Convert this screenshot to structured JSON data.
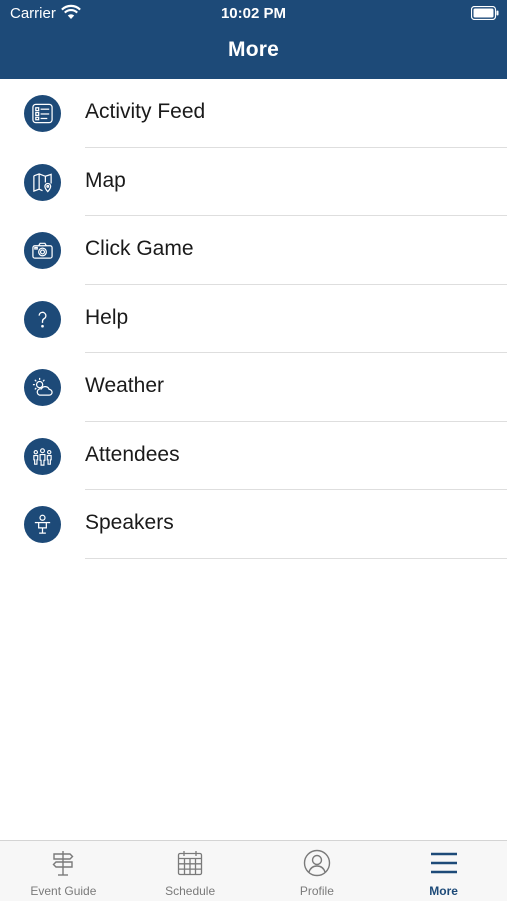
{
  "status_bar": {
    "carrier": "Carrier",
    "time": "10:02 PM"
  },
  "header": {
    "title": "More"
  },
  "menu": {
    "items": [
      {
        "label": "Activity Feed",
        "icon": "activity-feed-icon"
      },
      {
        "label": "Map",
        "icon": "map-icon"
      },
      {
        "label": "Click Game",
        "icon": "camera-icon"
      },
      {
        "label": "Help",
        "icon": "question-icon"
      },
      {
        "label": "Weather",
        "icon": "weather-icon"
      },
      {
        "label": "Attendees",
        "icon": "attendees-icon"
      },
      {
        "label": "Speakers",
        "icon": "speaker-icon"
      }
    ]
  },
  "tabbar": {
    "tabs": [
      {
        "label": "Event Guide",
        "icon": "signpost-icon",
        "active": false
      },
      {
        "label": "Schedule",
        "icon": "calendar-icon",
        "active": false
      },
      {
        "label": "Profile",
        "icon": "profile-icon",
        "active": false
      },
      {
        "label": "More",
        "icon": "hamburger-menu-icon",
        "active": true
      }
    ]
  },
  "colors": {
    "brand": "#1d4a78",
    "tab_inactive": "#7a7a7a",
    "divider": "#dedede"
  }
}
